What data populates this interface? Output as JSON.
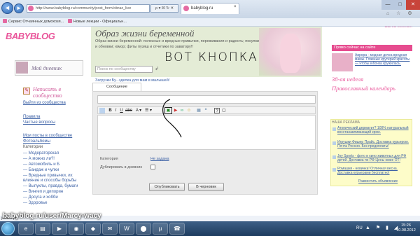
{
  "browser": {
    "address": "http://www.babyblog.ru/community/post_form/obraz_live",
    "tools_label": "ρ ▾ ☒ ↻ ✕",
    "tab_title": "babyblog.ru",
    "tab_close": "×",
    "window_min": "—",
    "window_max": "□",
    "window_close": "✕",
    "right_icons": "⌂ ☆ ⚙"
  },
  "favorites_bar": {
    "items": [
      "Сервис Отчаянных домохозя...",
      "Новые лекции - Официальн..."
    ]
  },
  "left": {
    "logo": "BABYBLOG",
    "diary_link": "Мой дневник",
    "write_link": "Написать в сообщество",
    "exit_link": "Выйти из сообщества",
    "rules_link": "Правила",
    "faq_link": "Частые вопросы",
    "my_posts_link": "Мои посты в сообществе",
    "albums_link": "Фотоальбомы",
    "categories_title": "Категории",
    "categories": [
      "— Модераторская",
      "— А можно ли?!",
      "— Автомобиль и Б",
      "— Бандаж и чулки",
      "— Вредные привычки, их",
      "   влияние и способы борьбы",
      "— Выпуклы, правда, бумаги",
      "— Вингеп и дипорин",
      "— Досуга и хобби",
      "— Здоровье"
    ]
  },
  "main": {
    "title": "Образ жизни беременной",
    "description": "Образ жизни беременной: полезные и вредные привычки, переживания и радость; покупки и обновки; юмор; фиты пузяш и отчетики по заватору!!",
    "search_placeholder": "Поиск по сообществу",
    "search_arrow": "↲",
    "breadcrumb": "Загрузки Бу...зделка для мам в малышей!",
    "tab_message": "Сообщение",
    "handwritten": "ВОТ КНОПКА",
    "category_label": "Категория",
    "category_value": "Не задана",
    "duplicate_label": "Дублировать в дневник",
    "publish_button": "Опубликовать",
    "draft_button": "В черновик"
  },
  "toolbar": {
    "bold": "B",
    "italic": "I",
    "underline": "U",
    "strike": "abe",
    "font_color": "A ▾",
    "highlight": "☰ ▾",
    "image_icon": "▣",
    "video_icon": "▶",
    "link_icon": "∞",
    "smile_icon": "☺",
    "table_icon": "▦",
    "quote_icon": "❝",
    "help_icon": "?",
    "box_icon": "▢"
  },
  "right": {
    "ad_top": "БЫТЬ МАМОЙ",
    "promo_header": "Прямо сейчас на сайте",
    "promo_text": "Аврора - модная дочка вредная мамы. Главные крутерий красоты — чтобы юбочка кружилась.",
    "week_link": "38-ая неделя",
    "calendar_link": "Православный календарь",
    "ads_title": "НАША РЕКЛАМА",
    "ads": [
      "Атопический дерматит? 100% натуральный восстанавливающий крем.",
      "Игрушки Фишер Прайс. Доставка курьером. Почта России. Без предоплаты!",
      "Joy Sports - фото и кино животных для РФ детей. Доставка по РФ Цены ниже ОТ!",
      "Ромашки - новинка! Отличная весна. Доставка курьерами бесплатно!"
    ],
    "ads_footer": "Разместить объявление"
  },
  "status": {
    "text": "javascript:;"
  },
  "overlay": {
    "url": "babyblog.ru/user/Marcy-wacy"
  },
  "taskbar": {
    "lang": "RU",
    "tray": "▲ ⚑ ▮ ◢",
    "time": "15:26",
    "date": "10.08.2012"
  }
}
